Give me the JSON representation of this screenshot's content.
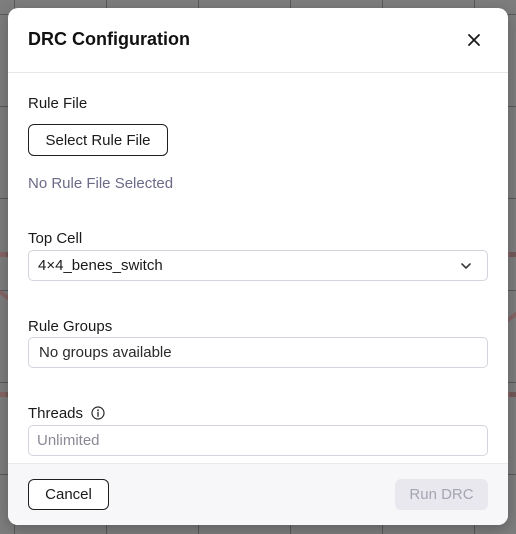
{
  "dialog": {
    "title": "DRC Configuration",
    "close_icon": "close-icon"
  },
  "rule_file": {
    "label": "Rule File",
    "button_label": "Select Rule File",
    "status_text": "No Rule File Selected"
  },
  "top_cell": {
    "label": "Top Cell",
    "selected_value": "4×4_benes_switch",
    "icon": "chevron-down-icon"
  },
  "rule_groups": {
    "label": "Rule Groups",
    "value": "No groups available"
  },
  "threads": {
    "label": "Threads",
    "placeholder": "Unlimited",
    "value": "",
    "icon": "info-icon"
  },
  "footer": {
    "cancel_label": "Cancel",
    "run_label": "Run DRC"
  },
  "colors": {
    "status_text": "#6b6b88",
    "run_button_bg": "#e8e8ee",
    "run_button_text": "#a5a5b3",
    "footer_bg": "#f7f7f9"
  }
}
